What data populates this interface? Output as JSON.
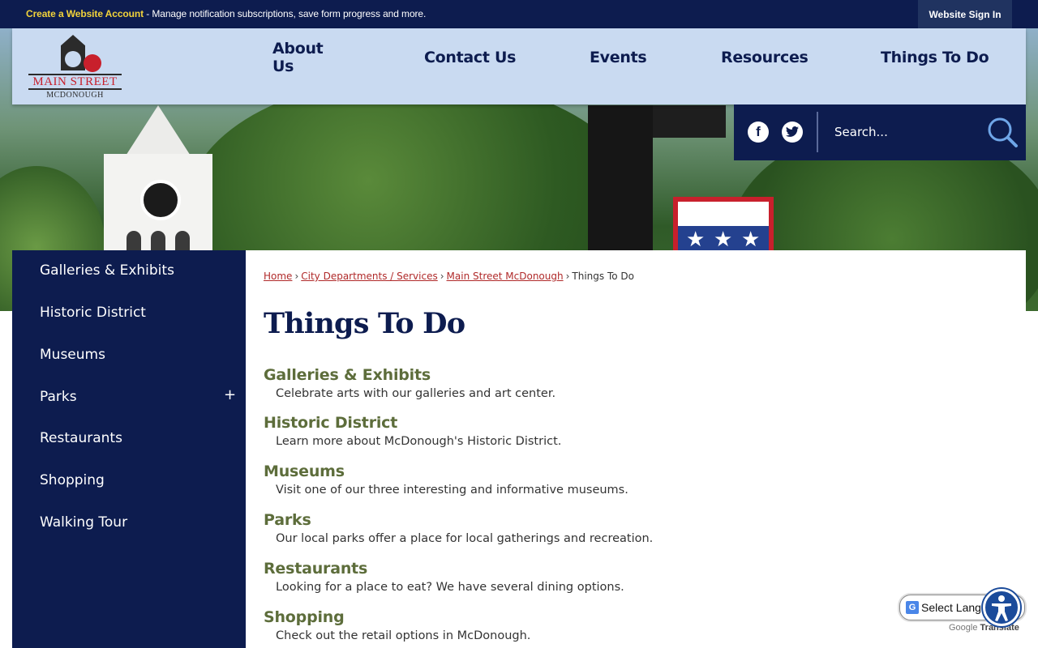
{
  "topbar": {
    "promo_link": "Create a Website Account",
    "promo_text": " - Manage notification subscriptions, save form progress and more.",
    "signin": "Website Sign In"
  },
  "logo": {
    "line1": "MAIN STREET",
    "line2": "MCDONOUGH"
  },
  "nav": [
    "About Us",
    "Contact Us",
    "Events",
    "Resources",
    "Things To Do"
  ],
  "social": {
    "facebook_icon": "facebook-icon",
    "twitter_icon": "twitter-icon",
    "search_placeholder": "Search..."
  },
  "sidebar": {
    "items": [
      "Galleries & Exhibits",
      "Historic District",
      "Museums",
      "Parks",
      "Restaurants",
      "Shopping",
      "Walking Tour"
    ],
    "expand": "+"
  },
  "breadcrumb": {
    "items": [
      "Home",
      "City Departments / Services",
      "Main Street McDonough"
    ],
    "current": "Things To Do",
    "separator": "›"
  },
  "page": {
    "title": "Things To Do",
    "entries": [
      {
        "title": "Galleries & Exhibits",
        "desc": "Celebrate arts with our galleries and art center."
      },
      {
        "title": "Historic District",
        "desc": "Learn more about McDonough's Historic District."
      },
      {
        "title": "Museums",
        "desc": "Visit one of our three interesting and informative museums."
      },
      {
        "title": "Parks",
        "desc": "Our local parks offer a place for local gatherings and recreation."
      },
      {
        "title": "Restaurants",
        "desc": "Looking for a place to eat? We have several dining options."
      },
      {
        "title": "Shopping",
        "desc": "Check out the retail options in McDonough."
      }
    ]
  },
  "translate": {
    "label": "Select Lang",
    "powered_google": "Google",
    "powered_translate": "Translate"
  },
  "colors": {
    "navy": "#0d1c4f",
    "header_bg": "#c9daf1",
    "entry_title": "#5d6d3b",
    "crumb_link": "#b02a2a",
    "promo_link": "#f2d33a"
  }
}
